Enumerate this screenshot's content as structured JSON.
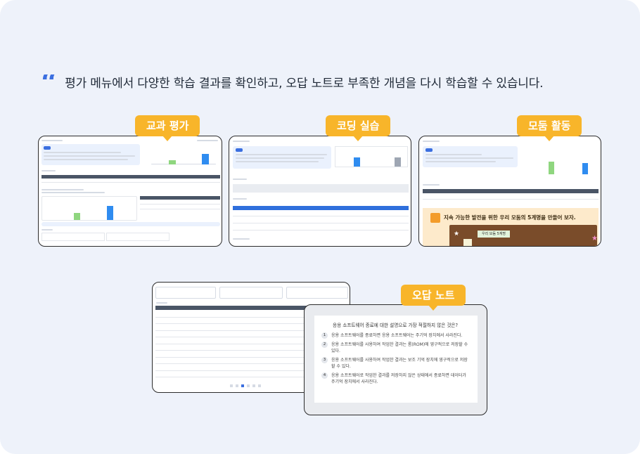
{
  "headline": "평가 메뉴에서 다양한 학습 결과를 확인하고, 오답 노트로 부족한 개념을 다시 학습할 수 있습니다.",
  "badges": {
    "subject_eval": "교과 평가",
    "coding_practice": "코딩 실습",
    "group_activity": "모둠 활동",
    "wrong_note": "오답 노트"
  },
  "colors": {
    "accent": "#3b6fe0",
    "badge": "#f8b52a",
    "panel_bg": "#eef2fa"
  },
  "group_activity": {
    "banner_text": "지속 가능한 발전을 위한 우리 모둠의 5계명을 만들어 보자.",
    "board_label": "우리 모둠 5계명"
  },
  "wrong_note": {
    "question": "응용 소프트웨어 종료에 대한 설명으로 가장 적절하지 않은 것은?",
    "options": [
      {
        "num": "1",
        "text": "응용 소프트웨어를 종료하면 응용 소프트웨어는 주기억 장치에서 사라진다."
      },
      {
        "num": "2",
        "text": "응용 소프트웨어를 사용하여 작업한 결과는 롬(ROM)에 영구적으로 저장할 수 있다."
      },
      {
        "num": "3",
        "text": "응용 소프트웨어를 사용하여 작업한 결과는 보조 기억 장치에 영구적으로 저장할 수 있다."
      },
      {
        "num": "4",
        "text": "응용 소프트웨어로 작업한 결과를 저장하지 않은 상태에서 종료하면 데이터가 주기억 장치에서 사라진다."
      }
    ]
  }
}
